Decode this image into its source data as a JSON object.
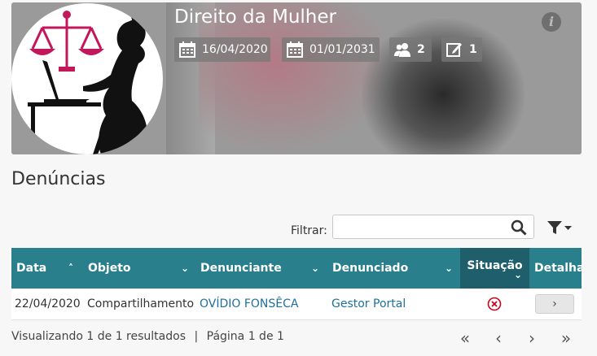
{
  "header": {
    "title": "Direito da Mulher",
    "start_date": "16/04/2020",
    "end_date": "01/01/2031",
    "members_count": "2",
    "posts_count": "1",
    "info_icon": "info-icon"
  },
  "section": {
    "heading": "Denúncias"
  },
  "filter": {
    "label": "Filtrar:",
    "placeholder": "",
    "value": ""
  },
  "table": {
    "columns": [
      {
        "label": "Data",
        "sort": "asc"
      },
      {
        "label": "Objeto",
        "sort": "dropdown"
      },
      {
        "label": "Denunciante",
        "sort": "dropdown"
      },
      {
        "label": "Denunciado",
        "sort": "dropdown"
      },
      {
        "label": "Situação",
        "sort": "dropdown"
      },
      {
        "label": "Detalha",
        "sort": "none"
      }
    ],
    "rows": [
      {
        "data": "22/04/2020",
        "objeto": "Compartilhamento",
        "denunciante": "OVÍDIO FONSÊCA",
        "denunciado": "Gestor Portal",
        "situacao": "rejected",
        "detalhes": "›"
      }
    ]
  },
  "pagination": {
    "summary": "Visualizando 1 de 1 resultados",
    "separator": "|",
    "page_text": "Página 1 de 1",
    "first": "«",
    "prev": "‹",
    "next": "›",
    "last": "»"
  },
  "colors": {
    "header_teal": "#2a7f8d",
    "active_column": "#1e5f6b",
    "link": "#1f6f99",
    "status_red": "#d0021b"
  }
}
